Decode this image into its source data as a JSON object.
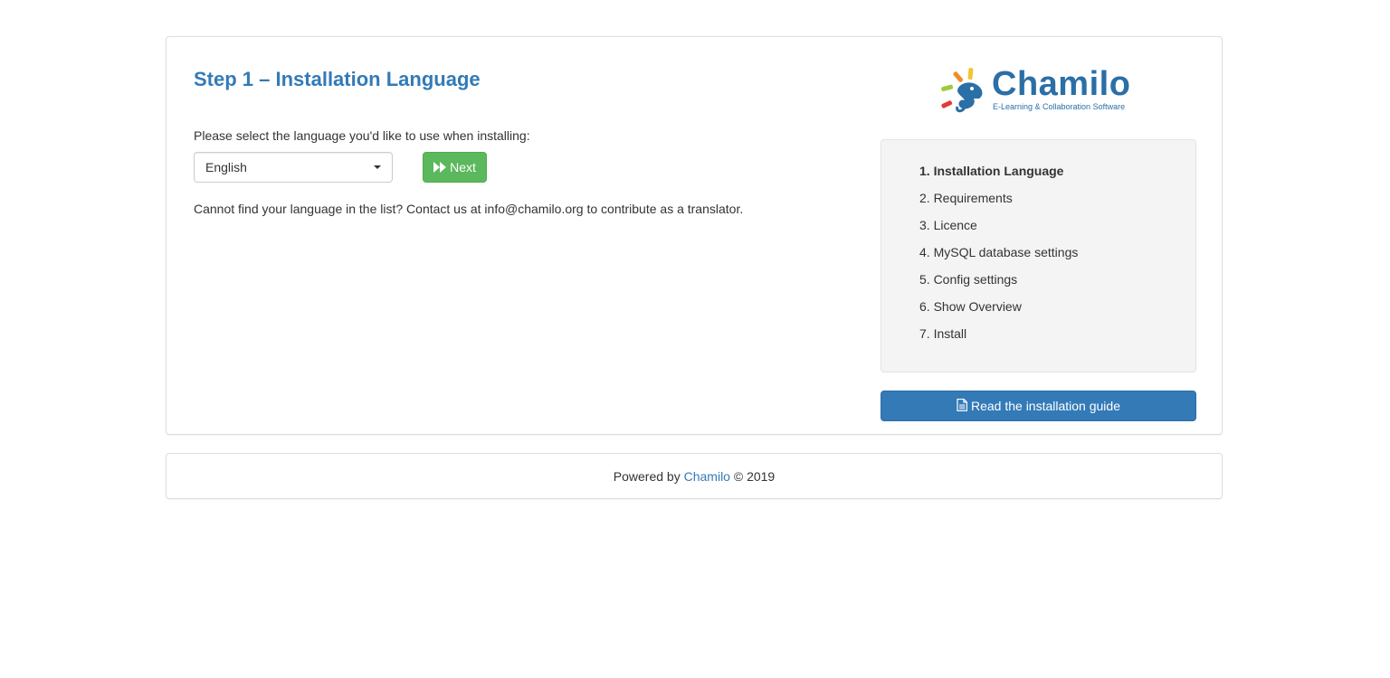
{
  "step": {
    "title": "Step 1 – Installation Language",
    "prompt": "Please select the language you'd like to use when installing:",
    "help_text": "Cannot find your language in the list? Contact us at info@chamilo.org to contribute as a translator."
  },
  "language_select": {
    "selected": "English"
  },
  "next_button": {
    "label": "Next",
    "icon": "fast-forward-icon",
    "color": "#5cb85c"
  },
  "logo": {
    "brand": "Chamilo",
    "tagline": "E-Learning & Collaboration Software"
  },
  "steps": [
    {
      "label": "1. Installation Language",
      "active": true
    },
    {
      "label": "2. Requirements",
      "active": false
    },
    {
      "label": "3. Licence",
      "active": false
    },
    {
      "label": "4. MySQL database settings",
      "active": false
    },
    {
      "label": "5. Config settings",
      "active": false
    },
    {
      "label": "6. Show Overview",
      "active": false
    },
    {
      "label": "7. Install",
      "active": false
    }
  ],
  "guide_button": {
    "label": "Read the installation guide",
    "icon": "document-icon",
    "color": "#337ab7"
  },
  "footer": {
    "prefix": "Powered by",
    "link": "Chamilo",
    "suffix": "© 2019"
  },
  "colors": {
    "accent": "#337ab7",
    "success": "#5cb85c",
    "brand": "#2a6fa6"
  }
}
